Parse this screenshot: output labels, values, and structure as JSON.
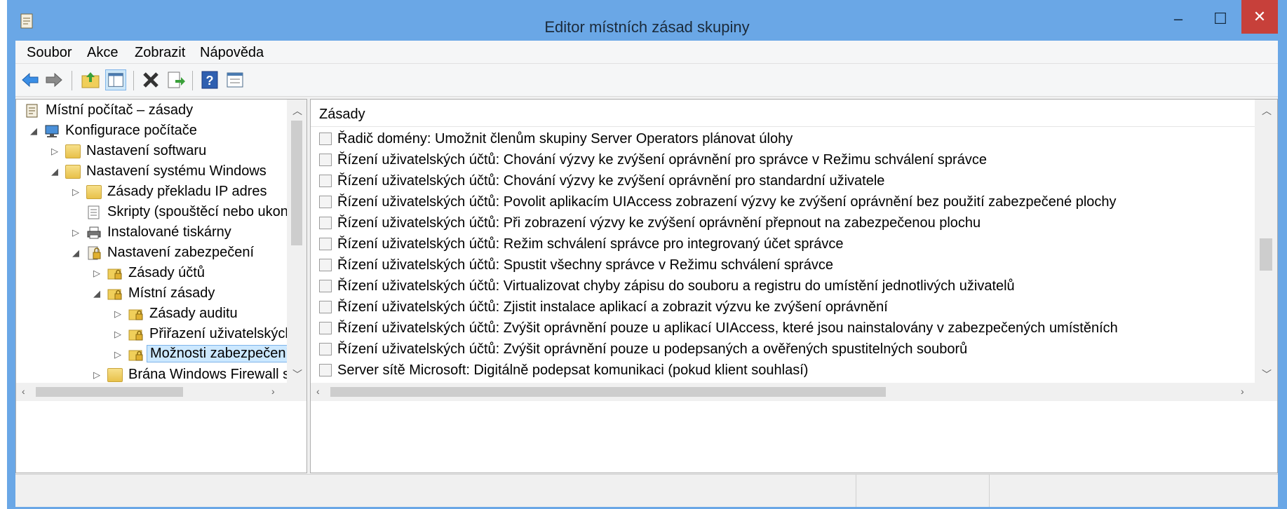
{
  "window": {
    "title": "Editor místních zásad skupiny",
    "controls": {
      "minimize": "–",
      "maximize": "☐",
      "close": "✕"
    }
  },
  "menu": {
    "items": [
      "Soubor",
      "Akce",
      "Zobrazit",
      "Nápověda"
    ]
  },
  "toolbar": {
    "buttons": [
      "back-icon",
      "forward-icon",
      "up-folder-icon",
      "show-hide-tree-icon",
      "delete-icon",
      "export-list-icon",
      "help-icon",
      "properties-icon"
    ]
  },
  "tree": {
    "items": [
      {
        "label": "Místní počítač – zásady",
        "icon": "policy-document-icon",
        "expander": ""
      },
      {
        "label": "Konfigurace počítače",
        "icon": "computer-icon",
        "expander": "expanded"
      },
      {
        "label": "Nastavení softwaru",
        "icon": "folder-icon",
        "expander": "collapsed"
      },
      {
        "label": "Nastavení systému Windows",
        "icon": "folder-icon",
        "expander": "expanded"
      },
      {
        "label": "Zásady překladu IP adres",
        "icon": "folder-icon",
        "expander": "collapsed"
      },
      {
        "label": "Skripty (spouštěcí nebo ukonč",
        "icon": "script-icon",
        "expander": ""
      },
      {
        "label": "Instalované tiskárny",
        "icon": "printer-icon",
        "expander": "collapsed"
      },
      {
        "label": "Nastavení zabezpečení",
        "icon": "security-settings-icon",
        "expander": "expanded"
      },
      {
        "label": "Zásady účtů",
        "icon": "security-folder-icon",
        "expander": "collapsed"
      },
      {
        "label": "Místní zásady",
        "icon": "security-folder-icon",
        "expander": "expanded"
      },
      {
        "label": "Zásady auditu",
        "icon": "security-folder-icon",
        "expander": "collapsed"
      },
      {
        "label": "Přiřazení uživatelských",
        "icon": "security-folder-icon",
        "expander": "collapsed"
      },
      {
        "label": "Možnosti zabezpečení",
        "icon": "security-folder-icon",
        "expander": "collapsed",
        "selected": true
      },
      {
        "label": "Brána Windows Firewall s p",
        "icon": "folder-icon",
        "expander": "collapsed"
      }
    ]
  },
  "list": {
    "column_header": "Zásady",
    "rows": [
      "Řadič domény: Umožnit členům skupiny Server Operators plánovat úlohy",
      "Řízení uživatelských účtů: Chování výzvy ke zvýšení oprávnění pro správce v Režimu schválení správce",
      "Řízení uživatelských účtů: Chování výzvy ke zvýšení oprávnění pro standardní uživatele",
      "Řízení uživatelských účtů: Povolit aplikacím UIAccess zobrazení výzvy ke zvýšení oprávnění bez použití zabezpečené plochy",
      "Řízení uživatelských účtů: Při zobrazení výzvy ke zvýšení oprávnění přepnout na zabezpečenou plochu",
      "Řízení uživatelských účtů: Režim schválení správce pro integrovaný účet správce",
      "Řízení uživatelských účtů: Spustit všechny správce v Režimu schválení správce",
      "Řízení uživatelských účtů: Virtualizovat chyby zápisu do souboru a registru do umístění jednotlivých uživatelů",
      "Řízení uživatelských účtů: Zjistit instalace aplikací a zobrazit výzvu ke zvýšení oprávnění",
      "Řízení uživatelských účtů: Zvýšit oprávnění pouze u aplikací UIAccess, které jsou nainstalovány v zabezpečených umístěních",
      "Řízení uživatelských účtů: Zvýšit oprávnění pouze u podepsaných a ověřených spustitelných souborů",
      "Server sítě Microsoft: Digitálně podepsat komunikaci (pokud klient souhlasí)"
    ]
  },
  "colors": {
    "title_bar": "#6aa7e6",
    "close_button": "#c7403a",
    "selection": "#cce8ff"
  }
}
